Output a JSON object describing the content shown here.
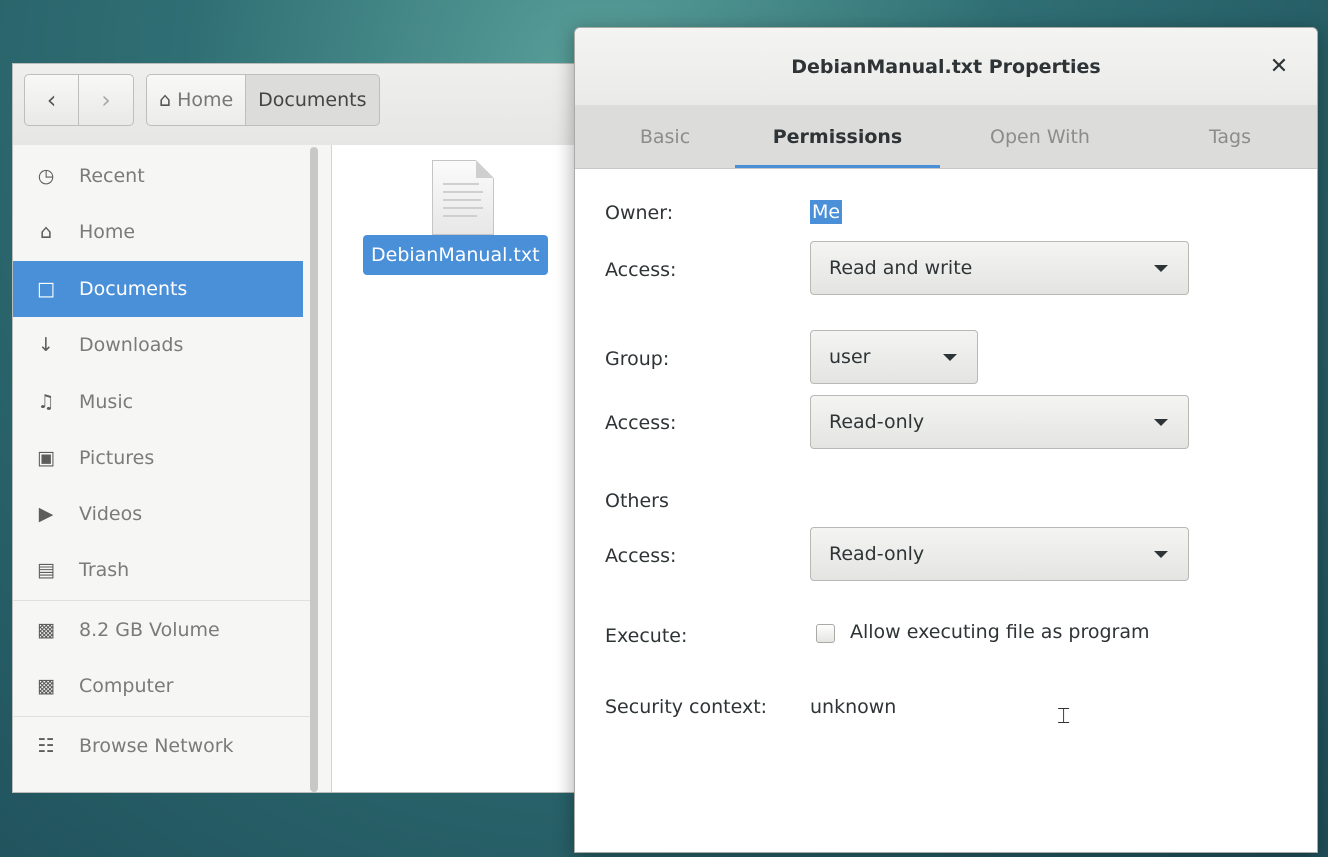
{
  "file_manager": {
    "nav": {
      "back_icon": "chevron-left-icon",
      "forward_icon": "chevron-right-icon"
    },
    "breadcrumb": {
      "home": "Home",
      "current": "Documents"
    },
    "sidebar": {
      "items": [
        {
          "label": "Recent",
          "icon": "clock-icon"
        },
        {
          "label": "Home",
          "icon": "home-icon"
        },
        {
          "label": "Documents",
          "icon": "document-icon",
          "selected": true
        },
        {
          "label": "Downloads",
          "icon": "download-icon"
        },
        {
          "label": "Music",
          "icon": "music-icon"
        },
        {
          "label": "Pictures",
          "icon": "camera-icon"
        },
        {
          "label": "Videos",
          "icon": "video-icon"
        },
        {
          "label": "Trash",
          "icon": "trash-icon"
        },
        {
          "label": "8.2 GB Volume",
          "icon": "drive-icon"
        },
        {
          "label": "Computer",
          "icon": "drive-icon"
        },
        {
          "label": "Browse Network",
          "icon": "network-icon"
        }
      ]
    },
    "files": [
      {
        "name": "DebianManual.txt",
        "icon": "text-file-icon",
        "selected": true
      }
    ]
  },
  "dialog": {
    "title": "DebianManual.txt Properties",
    "close_icon": "close-icon",
    "tabs": [
      "Basic",
      "Permissions",
      "Open With",
      "Tags"
    ],
    "active_tab": "Permissions",
    "owner_label": "Owner:",
    "owner_value": "Me",
    "owner_access_label": "Access:",
    "owner_access": "Read and write",
    "group_label": "Group:",
    "group_value": "user",
    "group_access_label": "Access:",
    "group_access": "Read-only",
    "others_label": "Others",
    "others_access_label": "Access:",
    "others_access": "Read-only",
    "execute_label": "Execute:",
    "execute_checkbox_label": "Allow executing file as program",
    "execute_checked": false,
    "security_label": "Security context:",
    "security_value": "unknown",
    "accent_color": "#4a90d9"
  }
}
